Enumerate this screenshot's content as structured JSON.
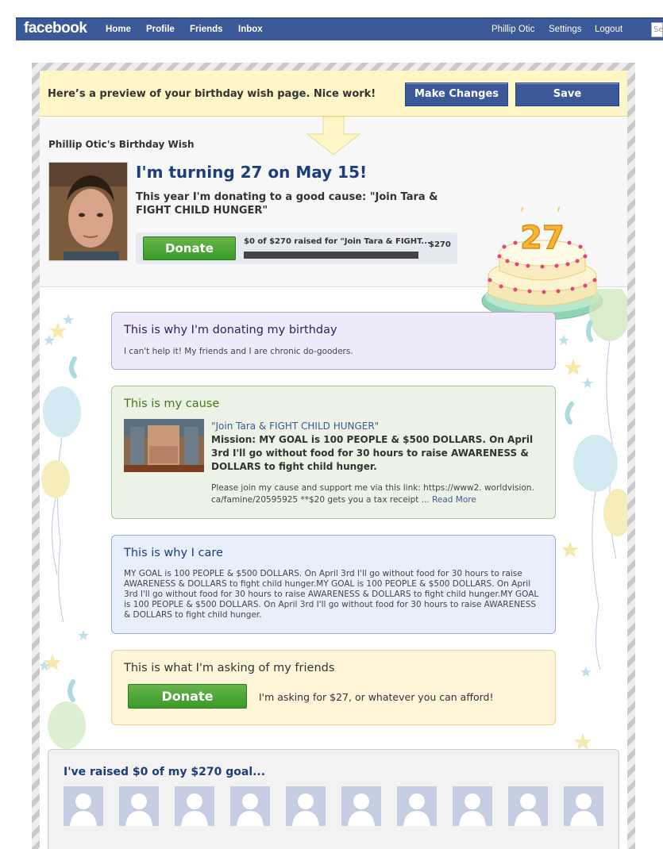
{
  "topbar": {
    "logo": "facebook",
    "nav": [
      "Home",
      "Profile",
      "Friends",
      "Inbox"
    ],
    "right_nav": [
      "Phillip Otic",
      "Settings",
      "Logout"
    ],
    "search_placeholder": "Se"
  },
  "preview": {
    "message": "Here’s a preview of your birthday wish page. Nice work!",
    "make_changes": "Make Changes",
    "save": "Save"
  },
  "header": {
    "wish_title": "Phillip Otic's Birthday Wish",
    "turning": "I'm turning 27 on May 15!",
    "donating": "This year I'm donating to a good cause: \"Join Tara & FIGHT CHILD HUNGER\"",
    "donate_label": "Donate",
    "raised_text": "$0 of $270 raised for \"Join Tara & FIGHT...",
    "goal_amount": "$270",
    "progress_fraction": 0,
    "cake_number": "27"
  },
  "why_donating": {
    "title": "This is why I'm donating my birthday",
    "text": "I can't help it! My friends and I are chronic do-gooders."
  },
  "cause": {
    "title": "This is my cause",
    "name": "\"Join Tara & FIGHT CHILD HUNGER\"",
    "mission": "Mission: MY GOAL is 100 PEOPLE & $500 DOLLARS. On April 3rd I'll go without food for 30 hours to raise AWARENESS & DOLLARS to fight child hunger.",
    "description": "Please join my cause and support me via this link: https://www2. worldvision. ca/famine/20595925 **$20 gets you a tax receipt ...",
    "read_more": "Read More"
  },
  "why_care": {
    "title": "This is why I care",
    "text": "MY GOAL is 100 PEOPLE & $500 DOLLARS. On April 3rd I'll go without food for 30 hours to raise AWARENESS & DOLLARS to fight child hunger.MY GOAL is 100 PEOPLE & $500 DOLLARS. On April 3rd I'll go without food for 30 hours to raise AWARENESS & DOLLARS to fight child hunger.MY GOAL is 100 PEOPLE & $500 DOLLARS. On April 3rd I'll go without food for 30 hours to raise AWARENESS & DOLLARS to fight child hunger."
  },
  "asking": {
    "title": "This is what I'm asking of my friends",
    "donate_label": "Donate",
    "text": "I'm asking for $27, or whatever you can afford!"
  },
  "raised_section": {
    "title": "I've raised $0 of my $270 goal...",
    "placeholder_count": 10
  },
  "colors": {
    "fb_blue": "#3b5998",
    "title_navy": "#1c3e7c",
    "donate_green": "#3a9a2a",
    "purple_box": "#eeeafa",
    "green_box": "#ecf3e6",
    "blue_box": "#e9eefb",
    "yellow_box": "#fff6d9"
  },
  "icons": [
    "arrow-down-icon",
    "cake-icon",
    "balloon-icon",
    "star-icon",
    "silhouette-icon"
  ]
}
